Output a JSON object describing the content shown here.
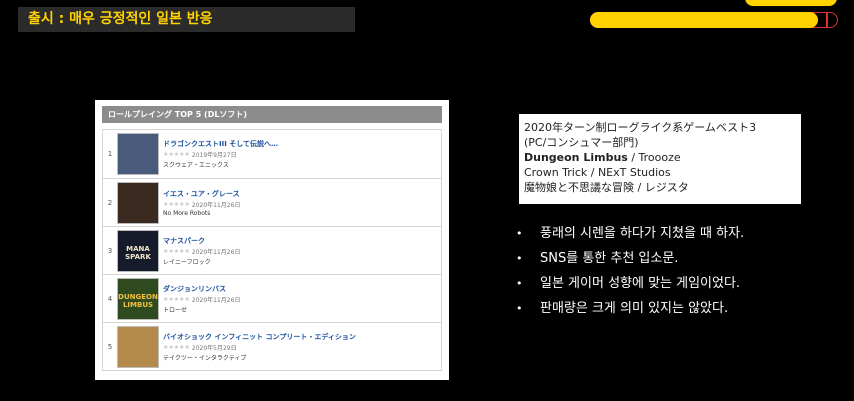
{
  "slide": {
    "title": "출시 : 매우 긍정적인 일본 반응",
    "progress": 0.92,
    "colors": {
      "accent": "#ffd200",
      "background": "#000000",
      "progress_border": "#e23030"
    }
  },
  "ranking": {
    "header": "ロールプレイング TOP 5 (DLソフト)",
    "items": [
      {
        "rank": "1",
        "title": "ドラゴンクエストIII そして伝説へ…",
        "date": "2019年9月27日",
        "publisher": "スクウェア・エニックス",
        "cover_color": "#4a5a7a",
        "cover_text": ""
      },
      {
        "rank": "2",
        "title": "イエス・ユア・グレース",
        "date": "2020年11月26日",
        "publisher": "No More Robots",
        "cover_color": "#3a2a20",
        "cover_text": ""
      },
      {
        "rank": "3",
        "title": "マナスパーク",
        "date": "2020年11月26日",
        "publisher": "レイニーフロック",
        "cover_color": "#151b2a",
        "cover_text": "MANA SPARK"
      },
      {
        "rank": "4",
        "title": "ダンジョンリンバス",
        "date": "2020年11月26日",
        "publisher": "トローゼ",
        "cover_color": "#2f4a1f",
        "cover_text": "DUNGEON LIMBUS"
      },
      {
        "rank": "5",
        "title": "バイオショック インフィニット コンプリート・エディション",
        "date": "2020年5月29日",
        "publisher": "テイクツー・インタラクティブ",
        "cover_color": "#b48a4a",
        "cover_text": ""
      }
    ]
  },
  "award": {
    "line1": "2020年ターン制ローグライク系ゲームベスト3",
    "line2": "(PC/コンシュマー部門)",
    "line3_bold": "Dungeon Limbus",
    "line3_rest": " / Troooze",
    "line4": "Crown Trick / NExT Studios",
    "line5": "魔物娘と不思議な冒険 / レジスタ"
  },
  "bullets": [
    "풍래의 시렌을 하다가 지쳤을 때 하자.",
    "SNS를 통한 추천 입소문.",
    "일본 게이머 성향에 맞는 게임이었다.",
    "판매량은 크게 의미 있지는 않았다."
  ]
}
